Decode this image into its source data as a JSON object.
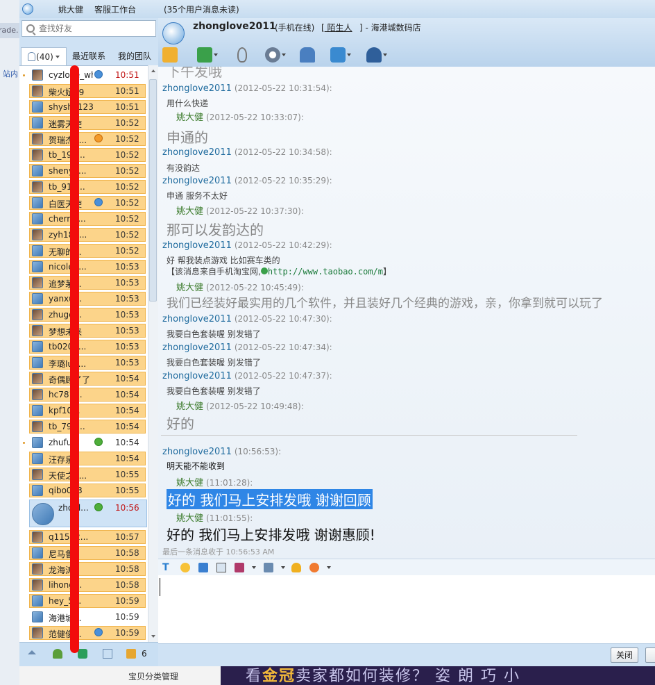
{
  "background": {
    "left_tab_text": "rade.",
    "left_link": "站内",
    "category_link": "宝贝分类管理",
    "banner_prefix": "看",
    "banner_highlight": "金冠",
    "banner_rest": "卖家都如何装修？ 姿 朗 巧 小"
  },
  "titlebar": {
    "user": "姚大健",
    "workbench": "客服工作台",
    "unread": "(35个用户消息未读)"
  },
  "search": {
    "placeholder": "查找好友"
  },
  "tabs": {
    "contacts_count": "(40)",
    "recent": "最近联系",
    "team": "我的团队"
  },
  "contacts": [
    {
      "name": "cyzlove_wh",
      "time": "10:51",
      "badge": "mobile",
      "hl": false,
      "dot": true,
      "time_red": true
    },
    {
      "name": "柴火妞09",
      "time": "10:51",
      "badge": "",
      "hl": true,
      "dot": false
    },
    {
      "name": "shyshy123",
      "time": "10:51",
      "badge": "",
      "hl": true,
      "dot": false
    },
    {
      "name": "迷雾天使",
      "time": "10:52",
      "badge": "",
      "hl": true,
      "dot": false
    },
    {
      "name": "贺瑞杰0...",
      "time": "10:52",
      "badge": "tmall",
      "hl": true,
      "dot": false
    },
    {
      "name": "tb_197...",
      "time": "10:52",
      "badge": "",
      "hl": true,
      "dot": false
    },
    {
      "name": "shenyx...",
      "time": "10:52",
      "badge": "",
      "hl": true,
      "dot": false
    },
    {
      "name": "tb_911...",
      "time": "10:52",
      "badge": "",
      "hl": true,
      "dot": false
    },
    {
      "name": "白医天使",
      "time": "10:52",
      "badge": "mobile",
      "hl": true,
      "dot": false
    },
    {
      "name": "cherri2...",
      "time": "10:52",
      "badge": "",
      "hl": true,
      "dot": false
    },
    {
      "name": "zyh183...",
      "time": "10:52",
      "badge": "",
      "hl": true,
      "dot": false
    },
    {
      "name": "无聊的...",
      "time": "10:52",
      "badge": "",
      "hl": true,
      "dot": false
    },
    {
      "name": "nicole1...",
      "time": "10:53",
      "badge": "",
      "hl": true,
      "dot": false
    },
    {
      "name": "追梦茅...",
      "time": "10:53",
      "badge": "",
      "hl": true,
      "dot": false
    },
    {
      "name": "yanxu...",
      "time": "10:53",
      "badge": "",
      "hl": true,
      "dot": false
    },
    {
      "name": "zhuge...",
      "time": "10:53",
      "badge": "",
      "hl": true,
      "dot": false
    },
    {
      "name": "梦想未来",
      "time": "10:53",
      "badge": "",
      "hl": true,
      "dot": false
    },
    {
      "name": "tb0200...",
      "time": "10:53",
      "badge": "",
      "hl": true,
      "dot": false
    },
    {
      "name": "李璐lu3...",
      "time": "10:53",
      "badge": "",
      "hl": true,
      "dot": false
    },
    {
      "name": "奇偶顾了了",
      "time": "10:54",
      "badge": "",
      "hl": true,
      "dot": false
    },
    {
      "name": "hc781...",
      "time": "10:54",
      "badge": "",
      "hl": true,
      "dot": false
    },
    {
      "name": "kpf10...",
      "time": "10:54",
      "badge": "",
      "hl": true,
      "dot": false
    },
    {
      "name": "tb_794...",
      "time": "10:54",
      "badge": "",
      "hl": true,
      "dot": false
    },
    {
      "name": "zhufu...",
      "time": "10:54",
      "badge": "check",
      "hl": false,
      "dot": true
    },
    {
      "name": "汪存泉",
      "time": "10:54",
      "badge": "",
      "hl": true,
      "dot": false
    },
    {
      "name": "天使之9...",
      "time": "10:55",
      "badge": "",
      "hl": true,
      "dot": false
    },
    {
      "name": "qibo013",
      "time": "10:55",
      "badge": "",
      "hl": true,
      "dot": false
    },
    {
      "name": "zhonl...",
      "time": "10:56",
      "badge": "check",
      "hl": false,
      "dot": false,
      "selected": true
    },
    {
      "name": "q11542...",
      "time": "10:57",
      "badge": "",
      "hl": true,
      "dot": false
    },
    {
      "name": "尼马鲁",
      "time": "10:58",
      "badge": "",
      "hl": true,
      "dot": false
    },
    {
      "name": "龙海涛3",
      "time": "10:58",
      "badge": "",
      "hl": true,
      "dot": false
    },
    {
      "name": "lihong...",
      "time": "10:58",
      "badge": "",
      "hl": true,
      "dot": false
    },
    {
      "name": "hey_5...",
      "time": "10:59",
      "badge": "",
      "hl": true,
      "dot": false
    },
    {
      "name": "海港城...",
      "time": "10:59",
      "badge": "",
      "hl": false,
      "dot": false
    },
    {
      "name": "范健俊...",
      "time": "10:59",
      "badge": "mobile",
      "hl": true,
      "dot": false
    }
  ],
  "left_toolbar": {
    "count": "6"
  },
  "header": {
    "name": "zhonglove2011",
    "status": "(手机在线)",
    "bracket_open": "[",
    "stranger": "陌生人",
    "shop": "] - 海港城数码店"
  },
  "chat": {
    "partial_top": "下午发哦",
    "messages": [
      {
        "sender": "zhonglove2011",
        "ts": "(2012-05-22 10:31:54):",
        "text": "用什么快递",
        "mine": false,
        "style": "normal"
      },
      {
        "sender": "姚大健",
        "ts": "(2012-05-22 10:33:07):",
        "text": "申通的",
        "mine": true,
        "style": "big"
      },
      {
        "sender": "zhonglove2011",
        "ts": "(2012-05-22 10:34:58):",
        "text": "有没韵达",
        "mine": false,
        "style": "normal"
      },
      {
        "sender": "zhonglove2011",
        "ts": "(2012-05-22 10:35:29):",
        "text": "申通    服务不太好",
        "mine": false,
        "style": "normal"
      },
      {
        "sender": "姚大健",
        "ts": "(2012-05-22 10:37:30):",
        "text": "那可以发韵达的",
        "mine": true,
        "style": "big"
      },
      {
        "sender": "zhonglove2011",
        "ts": "(2012-05-22 10:42:29):",
        "text": "好      帮我装点游戏      比如赛车类的",
        "mine": false,
        "style": "normal"
      },
      {
        "sender": "姚大健",
        "ts": "(2012-05-22 10:45:49):",
        "text": "我们已经装好最实用的几个软件，并且装好几个经典的游戏，亲，你拿到就可以玩了",
        "mine": true,
        "style": "biglight"
      },
      {
        "sender": "zhonglove2011",
        "ts": "(2012-05-22 10:47:30):",
        "text": "我要白色套装喔      别发错了",
        "mine": false,
        "style": "normal"
      },
      {
        "sender": "zhonglove2011",
        "ts": "(2012-05-22 10:47:34):",
        "text": "我要白色套装喔      别发错了",
        "mine": false,
        "style": "normal"
      },
      {
        "sender": "zhonglove2011",
        "ts": "(2012-05-22 10:47:37):",
        "text": "我要白色套装喔      别发错了",
        "mine": false,
        "style": "normal"
      },
      {
        "sender": "姚大健",
        "ts": "(2012-05-22 10:49:48):",
        "text": "好的",
        "mine": true,
        "style": "big"
      },
      {
        "sender": "zhonglove2011",
        "ts": "(10:56:53):",
        "text": "明天能不能收到",
        "mine": false,
        "style": "dark"
      },
      {
        "sender": "姚大健",
        "ts": "(11:01:28):",
        "text": "好的   我们马上安排发哦       谢谢回顾",
        "mine": true,
        "style": "selected"
      },
      {
        "sender": "姚大健",
        "ts": "(11:01:55):",
        "text": "好的   我们马上安排发哦       谢谢惠顾!",
        "mine": true,
        "style": "final"
      }
    ],
    "taobao_prefix": "【该消息来自手机淘宝网,",
    "taobao_link": "http://www.taobao.com/m",
    "taobao_suffix": "】",
    "last_message_note": "最后一条消息收于 10:56:53 AM"
  },
  "bottom": {
    "close_label": "关闭"
  },
  "colors": {
    "highlight": "#fcd48a",
    "selection": "#2f86e6",
    "red_annotation": "#f20c0c"
  }
}
